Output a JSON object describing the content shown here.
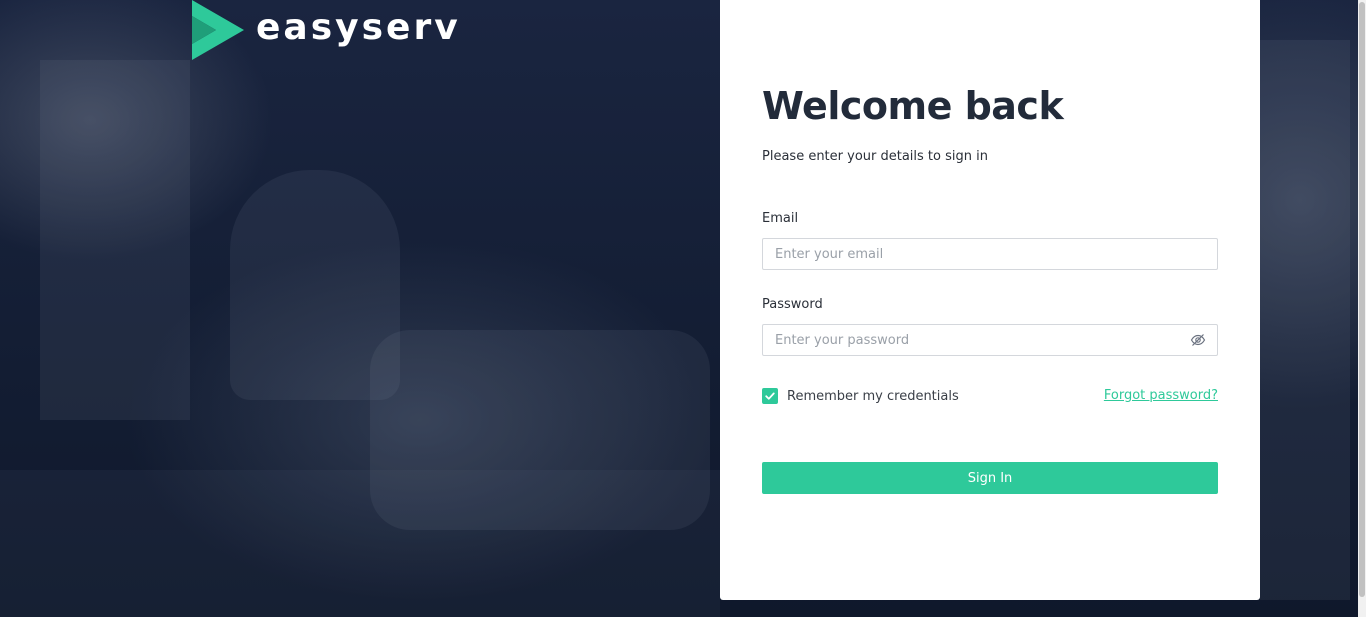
{
  "brand": {
    "name": "easyserv",
    "logo_icon": "play-chevron-logo-icon",
    "accent_color": "#2ec99a"
  },
  "login": {
    "title": "Welcome back",
    "subtitle": "Please enter your details to sign in",
    "email": {
      "label": "Email",
      "placeholder": "Enter your email",
      "value": ""
    },
    "password": {
      "label": "Password",
      "placeholder": "Enter your password",
      "value": "",
      "toggle_icon": "eye-slash-icon"
    },
    "remember": {
      "label": "Remember my credentials",
      "checked": true
    },
    "forgot_label": "Forgot password?",
    "submit_label": "Sign In"
  }
}
